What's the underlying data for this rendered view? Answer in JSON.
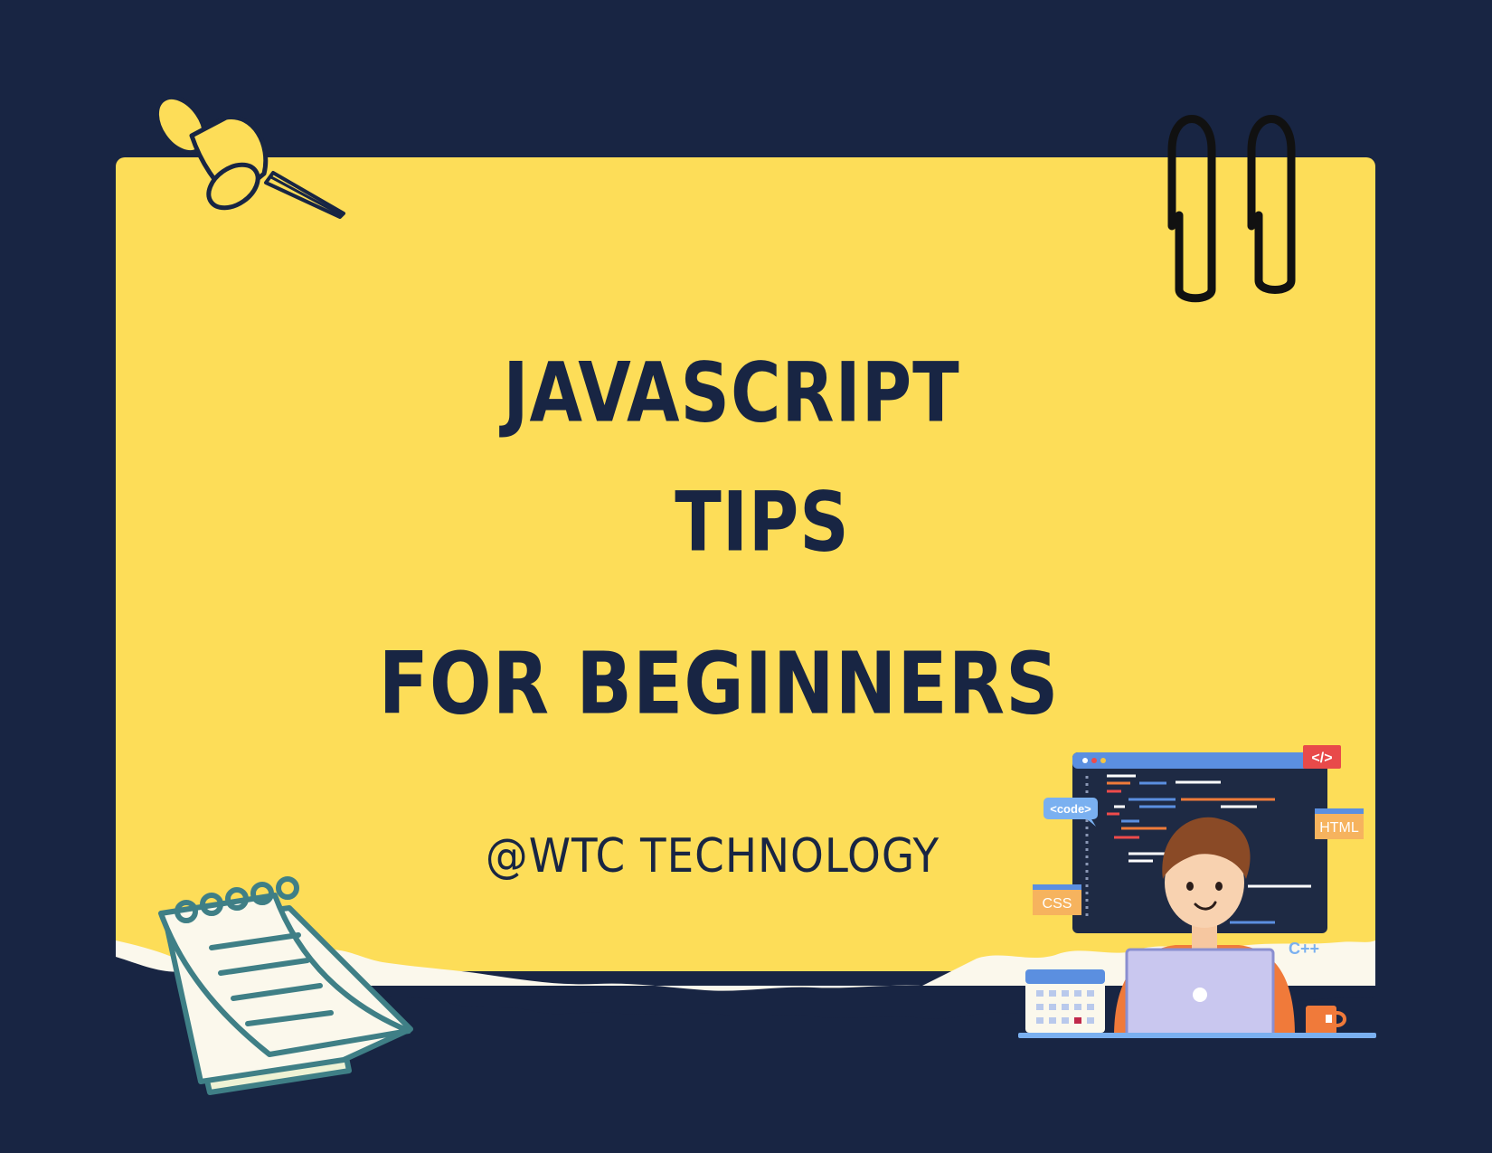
{
  "title": {
    "line1": "JAVASCRIPT",
    "line2": "TIPS",
    "line3": "FOR BEGINNERS"
  },
  "handle": "@WTC TECHNOLOGY",
  "illustration": {
    "code_tag": "<code>",
    "html_tag": "HTML",
    "css_tag": "CSS",
    "cpp_tag": "C++",
    "closing_tag": "</>"
  },
  "colors": {
    "background": "#182543",
    "paper": "#fddd58",
    "torn_edge": "#fbf8ec",
    "pin": "#fddd58",
    "notepad": "#3f7f86",
    "monitor": "#1e2a44",
    "accent_blue": "#5b8fe0",
    "shirt": "#f07a3a"
  },
  "icons": [
    "pushpin-icon",
    "paperclip-icon",
    "notepad-icon",
    "developer-illustration"
  ]
}
